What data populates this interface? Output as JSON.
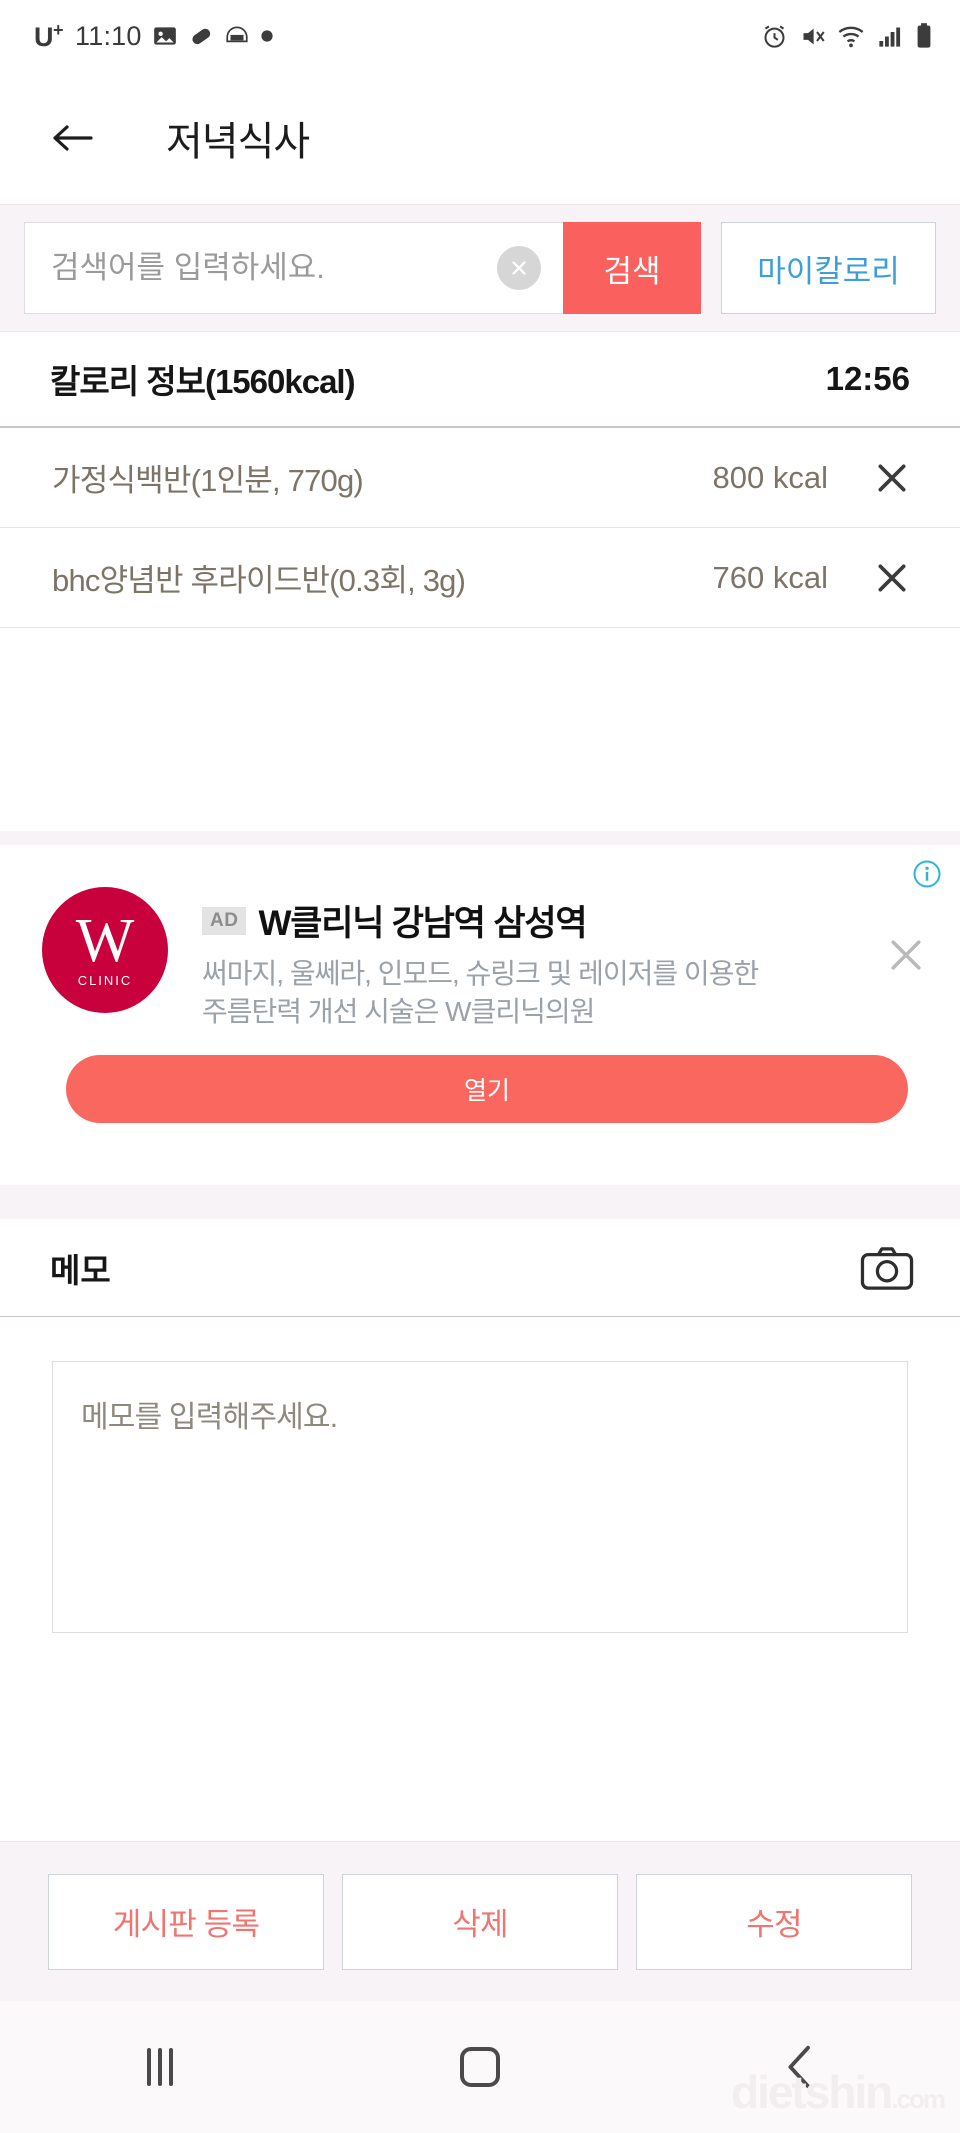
{
  "statusbar": {
    "carrier": "U",
    "carrier_sup": "+",
    "time": "11:10",
    "left_icons": [
      "image-icon",
      "pill-icon",
      "dashin-icon",
      "dot-icon"
    ],
    "right_icons": [
      "alarm-icon",
      "mute-icon",
      "wifi-icon",
      "signal-icon",
      "battery-icon"
    ]
  },
  "appbar": {
    "back_icon": "arrow-left-icon",
    "title": "저녁식사"
  },
  "search": {
    "placeholder": "검색어를 입력하세요.",
    "value": "",
    "clear_icon": "circle-close-icon",
    "search_label": "검색",
    "mycalorie_label": "마이칼로리",
    "search_btn_color": "#f9605e",
    "mycalorie_color": "#3e9fd8"
  },
  "calorie": {
    "title": "칼로리 정보(1560kcal)",
    "total_kcal": "1560kcal",
    "time": "12:56",
    "items": [
      {
        "name": "가정식백반(1인분, 770g)",
        "kcal": "800 kcal",
        "delete_icon": "close-icon"
      },
      {
        "name": "bhc양념반 후라이드반(0.3회, 3g)",
        "kcal": "760 kcal",
        "delete_icon": "close-icon"
      }
    ]
  },
  "ad": {
    "badge": "AD",
    "logo_letter": "W",
    "logo_sub": "CLINIC",
    "logo_color": "#c8003c",
    "title": "W클리닉 강남역 삼성역",
    "description": "써마지, 울쎄라, 인모드, 슈링크 및 레이저를 이용한 주름탄력 개선 시술은 W클리닉의원",
    "cta_label": "열기",
    "cta_color": "#f9675f",
    "info_icon": "info-icon",
    "close_icon": "close-icon"
  },
  "memo": {
    "label": "메모",
    "camera_icon": "camera-icon",
    "placeholder": "메모를 입력해주세요.",
    "value": ""
  },
  "actions": {
    "buttons": [
      {
        "label": "게시판 등록"
      },
      {
        "label": "삭제"
      },
      {
        "label": "수정"
      }
    ],
    "text_color": "#f07470"
  },
  "navbar": {
    "recents_icon": "recents-icon",
    "home_icon": "home-icon",
    "back_icon": "back-chevron-icon",
    "watermark": "dietshin",
    "watermark_domain": ".com"
  }
}
